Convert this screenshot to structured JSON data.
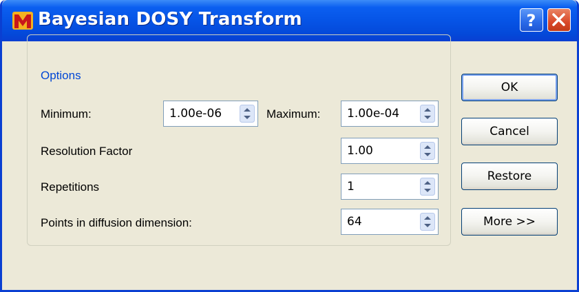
{
  "window": {
    "title": "Bayesian DOSY Transform",
    "icons": {
      "app": "app-logo-icon",
      "help": "question-mark-icon",
      "close": "close-x-icon"
    }
  },
  "options": {
    "group_title": "Options",
    "minimum": {
      "label": "Minimum:",
      "value": "1.00e-06"
    },
    "maximum": {
      "label": "Maximum:",
      "value": "1.00e-04"
    },
    "resolution": {
      "label": "Resolution Factor",
      "value": "1.00"
    },
    "repetitions": {
      "label": "Repetitions",
      "value": "1"
    },
    "points": {
      "label": "Points in diffusion dimension:",
      "value": "64"
    }
  },
  "buttons": {
    "ok": "OK",
    "cancel": "Cancel",
    "restore": "Restore",
    "more": "More >>"
  },
  "colors": {
    "titlebar": "#0654e6",
    "dialog_bg": "#ece9d8",
    "group_title": "#0046d5",
    "input_border": "#7f9db9"
  }
}
